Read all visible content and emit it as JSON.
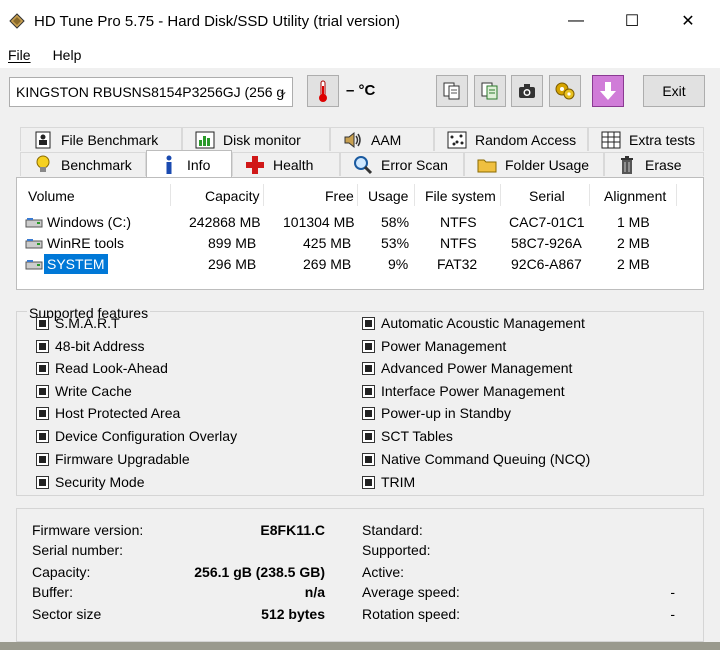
{
  "window": {
    "title": "HD Tune Pro 5.75 - Hard Disk/SSD Utility (trial version)",
    "minimize": "—",
    "maximize": "☐",
    "close": "✕"
  },
  "menu": {
    "file": "File",
    "help": "Help"
  },
  "toolbar": {
    "drive": "KINGSTON RBUSNS8154P3256GJ (256 g",
    "temperature": "– °C",
    "exit_label": "Exit"
  },
  "tabs": {
    "row1": [
      {
        "label": "File Benchmark",
        "icon": "file-benchmark-icon"
      },
      {
        "label": "Disk monitor",
        "icon": "disk-monitor-icon"
      },
      {
        "label": "AAM",
        "icon": "speaker-icon"
      },
      {
        "label": "Random Access",
        "icon": "random-access-icon"
      },
      {
        "label": "Extra tests",
        "icon": "extra-tests-icon"
      }
    ],
    "row2": [
      {
        "label": "Benchmark",
        "icon": "lightbulb-icon"
      },
      {
        "label": "Info",
        "icon": "info-icon"
      },
      {
        "label": "Health",
        "icon": "health-cross-icon"
      },
      {
        "label": "Error Scan",
        "icon": "magnifier-icon"
      },
      {
        "label": "Folder Usage",
        "icon": "folder-icon"
      },
      {
        "label": "Erase",
        "icon": "trash-icon"
      }
    ]
  },
  "volumes": {
    "headers": [
      "Volume",
      "Capacity",
      "Free",
      "Usage",
      "File system",
      "Serial",
      "Alignment"
    ],
    "rows": [
      {
        "volume": "Windows (C:)",
        "capacity": "242868 MB",
        "free": "101304 MB",
        "usage": "58%",
        "fs": "NTFS",
        "serial": "CAC7-01C1",
        "alignment": "1 MB"
      },
      {
        "volume": "WinRE tools",
        "capacity": "899 MB",
        "free": "425 MB",
        "usage": "53%",
        "fs": "NTFS",
        "serial": "58C7-926A",
        "alignment": "2 MB"
      },
      {
        "volume": "SYSTEM",
        "capacity": "296 MB",
        "free": "269 MB",
        "usage": "9%",
        "fs": "FAT32",
        "serial": "92C6-A867",
        "alignment": "2 MB"
      }
    ]
  },
  "features": {
    "title": "Supported features",
    "left": [
      "S.M.A.R.T",
      "48-bit Address",
      "Read Look-Ahead",
      "Write Cache",
      "Host Protected Area",
      "Device Configuration Overlay",
      "Firmware Upgradable",
      "Security Mode"
    ],
    "right": [
      "Automatic Acoustic Management",
      "Power Management",
      "Advanced Power Management",
      "Interface Power Management",
      "Power-up in Standby",
      "SCT Tables",
      "Native Command Queuing (NCQ)",
      "TRIM"
    ]
  },
  "info": {
    "left_labels": [
      "Firmware version:",
      "Serial number:",
      "Capacity:",
      "Buffer:",
      "Sector size"
    ],
    "left_values": [
      "E8FK11.C",
      "",
      "256.1 gB (238.5 GB)",
      "n/a",
      "512 bytes"
    ],
    "right_labels": [
      "Standard:",
      "Supported:",
      "Active:",
      "Average speed:",
      "Rotation speed:"
    ],
    "right_values": [
      "",
      "",
      "",
      "-",
      "-"
    ]
  }
}
